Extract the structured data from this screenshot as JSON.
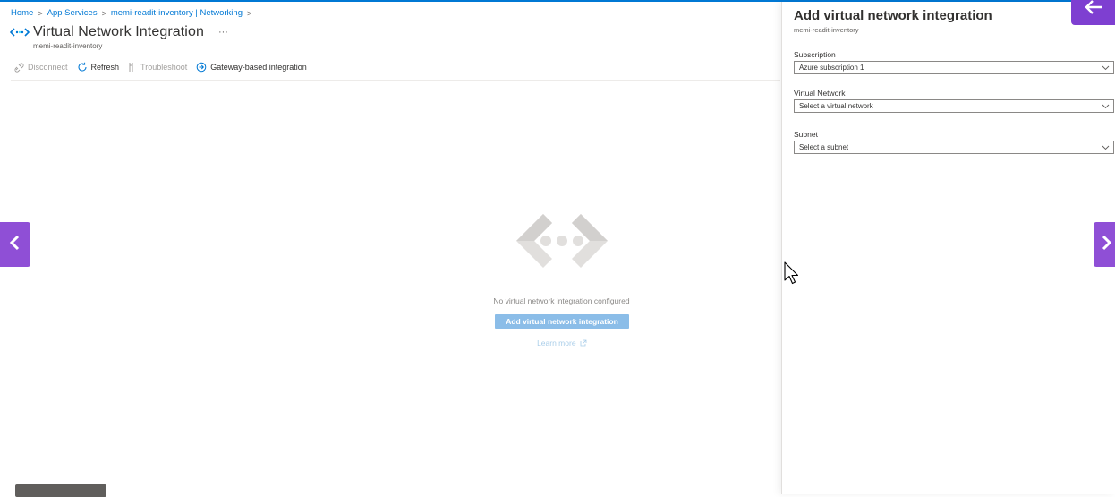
{
  "breadcrumb": {
    "items": [
      "Home",
      "App Services",
      "memi-readit-inventory | Networking"
    ],
    "separator": ">"
  },
  "header": {
    "title": "Virtual Network Integration",
    "more": "···",
    "subtitle": "memi-readit-inventory"
  },
  "toolbar": {
    "disconnect": "Disconnect",
    "refresh": "Refresh",
    "troubleshoot": "Troubleshoot",
    "gateway": "Gateway-based integration"
  },
  "empty_state": {
    "message": "No virtual network integration configured",
    "button": "Add virtual network integration",
    "learn_more": "Learn more"
  },
  "panel": {
    "title": "Add virtual network integration",
    "subtitle": "memi-readit-inventory",
    "subscription": {
      "label": "Subscription",
      "value": "Azure subscription 1"
    },
    "virtual_network": {
      "label": "Virtual Network",
      "placeholder": "Select a virtual network"
    },
    "subnet": {
      "label": "Subnet",
      "placeholder": "Select a subnet"
    }
  },
  "icons": {
    "title": "vnet-icon",
    "disconnect": "unlink-icon",
    "refresh": "refresh-icon",
    "troubleshoot": "troubleshoot-icon",
    "gateway": "gateway-arrow-icon",
    "empty": "vnet-large-icon",
    "external": "external-link-icon",
    "prev": "chevron-left-icon",
    "next": "chevron-right-icon",
    "back": "arrow-left-icon",
    "cursor": "mouse-cursor-icon"
  },
  "colors": {
    "accent": "#0078d4",
    "nav_purple": "#8f4fd6",
    "button_disabled_blue": "#8bbde8"
  }
}
